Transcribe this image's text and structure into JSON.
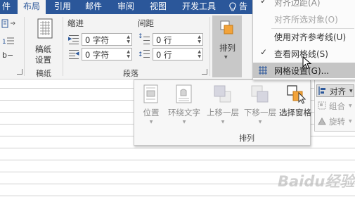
{
  "tabs": {
    "home_partial": "件",
    "layout": "布局",
    "references": "引用",
    "mailings": "邮件",
    "review": "审阅",
    "view": "视图",
    "developer": "开发工具",
    "tell_me": "告"
  },
  "ribbon": {
    "paper_group": {
      "button": "稿纸\n设置",
      "line1": "稿纸",
      "line2": "设置",
      "label": "稿纸"
    },
    "paragraph": {
      "indent_label": "缩进",
      "spacing_label": "间距",
      "indent_left": "0 字符",
      "indent_right": "0 字符",
      "spacing_before": "0 行",
      "spacing_after": "0 行",
      "label": "段落"
    },
    "arrange_button": "排列",
    "page_setup_partial": "b−"
  },
  "arrange_panel": {
    "position": "位置",
    "wrap_text": "环绕文字",
    "bring_forward": "上移一层",
    "send_backward": "下移一层",
    "selection_pane": "选择窗格",
    "label": "排列",
    "align": "对齐",
    "group": "组合",
    "rotate": "旋转"
  },
  "align_menu": {
    "items": [
      {
        "check": "✓",
        "text": "对齐边距(A)"
      },
      {
        "check": "",
        "text": "对齐所选对象(O)"
      },
      {
        "check": "",
        "text": "使用对齐参考线(U)"
      },
      {
        "check": "✓",
        "text": "查看网格线(S)"
      },
      {
        "check": "",
        "text": "网格设置(G)..."
      }
    ]
  },
  "watermark": "Baidu经验",
  "colors": {
    "ribbon_blue": "#2b579a",
    "selection_orange": "#f2a33a"
  }
}
